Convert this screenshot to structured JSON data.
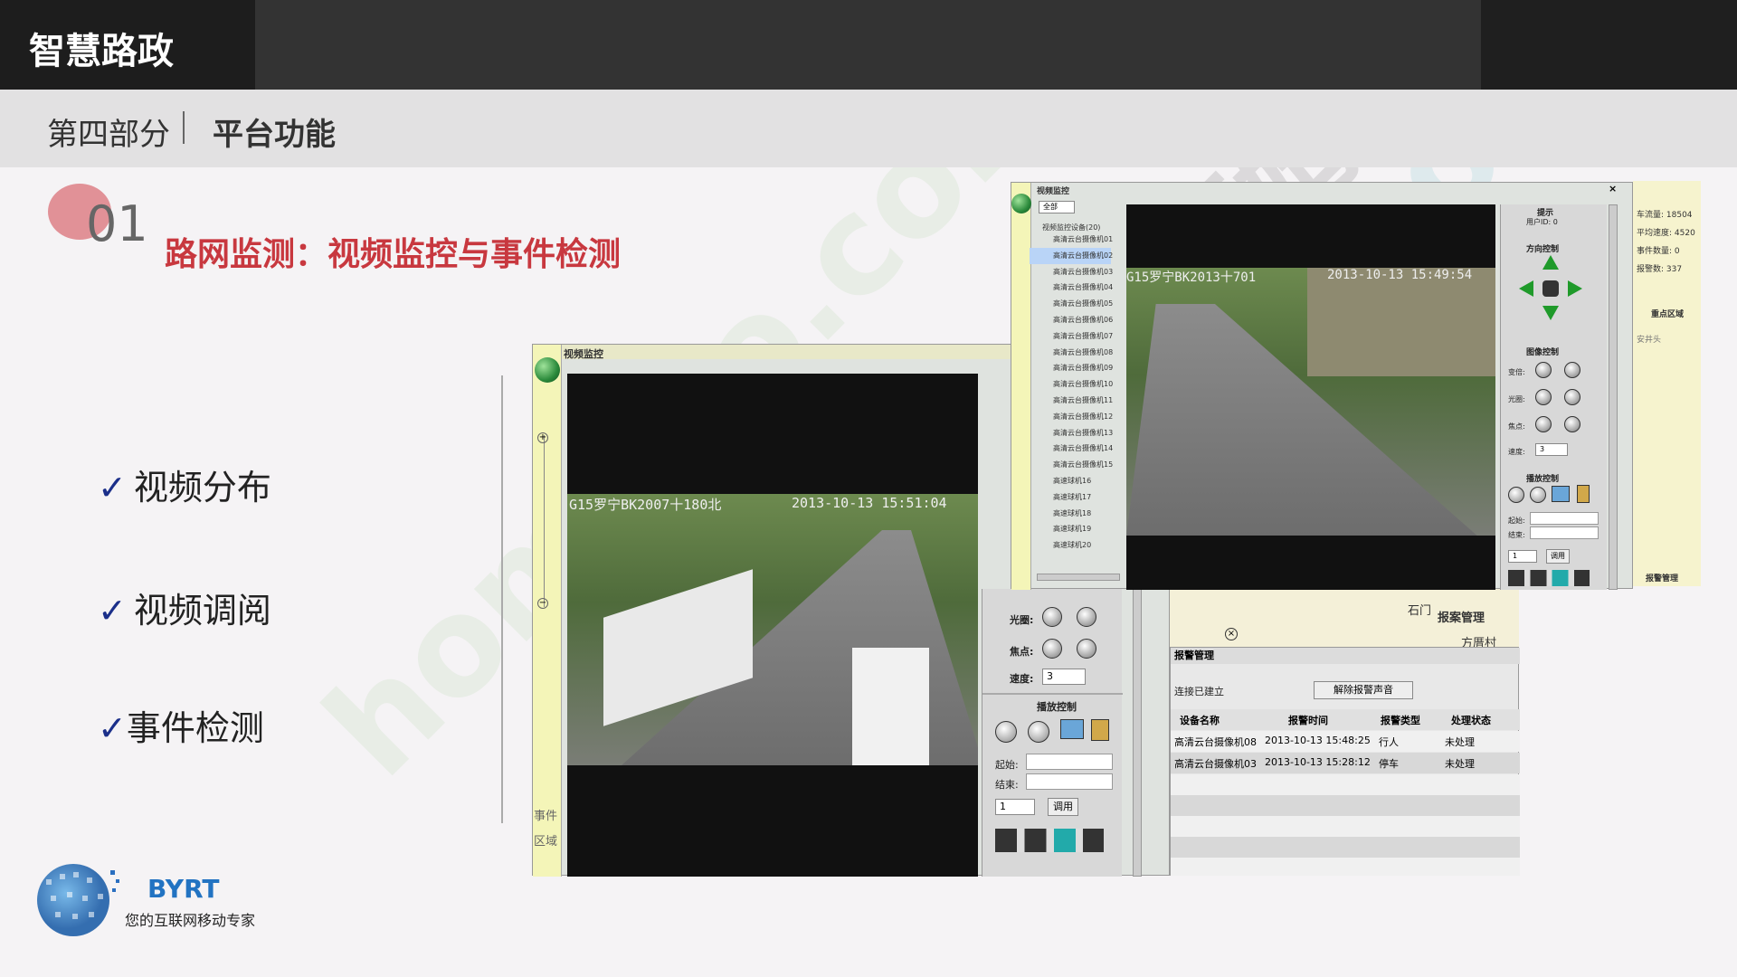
{
  "header": {
    "brand": "智慧路政",
    "section_part": "第四部分",
    "section_name": "平台功能"
  },
  "section": {
    "number": "01",
    "title": "路网监测：视频监控与事件检测"
  },
  "bullets": [
    {
      "check": "✓",
      "label": "视频分布"
    },
    {
      "check": "✓",
      "label": "视频调阅"
    },
    {
      "check": "✓",
      "label": "事件检测"
    }
  ],
  "logo": {
    "name": "BYRT",
    "tagline": "您的互联网移动专家"
  },
  "watermark": {
    "text1": "homedo.com",
    "text2": "河姆渡"
  },
  "screenshot_left": {
    "title": "视频监控",
    "osd_left": "G15罗宁BK2007十180北",
    "osd_right": "2013-10-13  15:51:04",
    "side_labels": [
      "事件",
      "区域"
    ],
    "controls": {
      "aperture": "光圈:",
      "focus": "焦点:",
      "speed": "速度:",
      "speed_value": "3",
      "playback": "播放控制",
      "start": "起始:",
      "end": "结束:",
      "page_value": "1",
      "fetch": "调用"
    },
    "right_strip_label": "石"
  },
  "screenshot_right": {
    "title": "视频监控",
    "close": "×",
    "dropdown": "全部",
    "tree_root": "视频监控设备(20)",
    "tree_items": [
      "高清云台摄像机01",
      "高清云台摄像机02",
      "高清云台摄像机03",
      "高清云台摄像机04",
      "高清云台摄像机05",
      "高清云台摄像机06",
      "高清云台摄像机07",
      "高清云台摄像机08",
      "高清云台摄像机09",
      "高清云台摄像机10",
      "高清云台摄像机11",
      "高清云台摄像机12",
      "高清云台摄像机13",
      "高清云台摄像机14",
      "高清云台摄像机15",
      "高速球机16",
      "高速球机17",
      "高速球机18",
      "高速球机19",
      "高速球机20"
    ],
    "osd_left": "G15罗宁BK2013十701",
    "osd_right": "2013-10-13  15:49:54",
    "controls": {
      "tip": "提示",
      "user_id": "用户ID: 0",
      "direction": "方向控制",
      "image": "图像控制",
      "zoom": "变倍:",
      "aperture": "光圈:",
      "focus": "焦点:",
      "speed": "速度:",
      "speed_value": "3",
      "playback": "播放控制",
      "start": "起始:",
      "end": "结束:",
      "page_value": "1",
      "fetch": "调用"
    }
  },
  "map_panel": {
    "stats": [
      "车流量: 18504",
      "平均速度: 4520",
      "事件数量: 0",
      "报警数: 337"
    ],
    "labels": [
      "重点区域",
      "安井头",
      "报警管理"
    ]
  },
  "map_area": {
    "labels": [
      "石门",
      "报案管理",
      "方厝村"
    ]
  },
  "alarm": {
    "title": "报警管理",
    "connection": "连接已建立",
    "clear_sound": "解除报警声音",
    "columns": [
      "设备名称",
      "报警时间",
      "报警类型",
      "处理状态"
    ],
    "rows": [
      [
        "高清云台摄像机08",
        "2013-10-13 15:48:25",
        "行人",
        "未处理"
      ],
      [
        "高清云台摄像机03",
        "2013-10-13 15:28:12",
        "停车",
        "未处理"
      ]
    ]
  },
  "colors": {
    "title_red": "#c8383f",
    "check_blue": "#1b2f8a",
    "logo_blue": "#2273c2"
  }
}
